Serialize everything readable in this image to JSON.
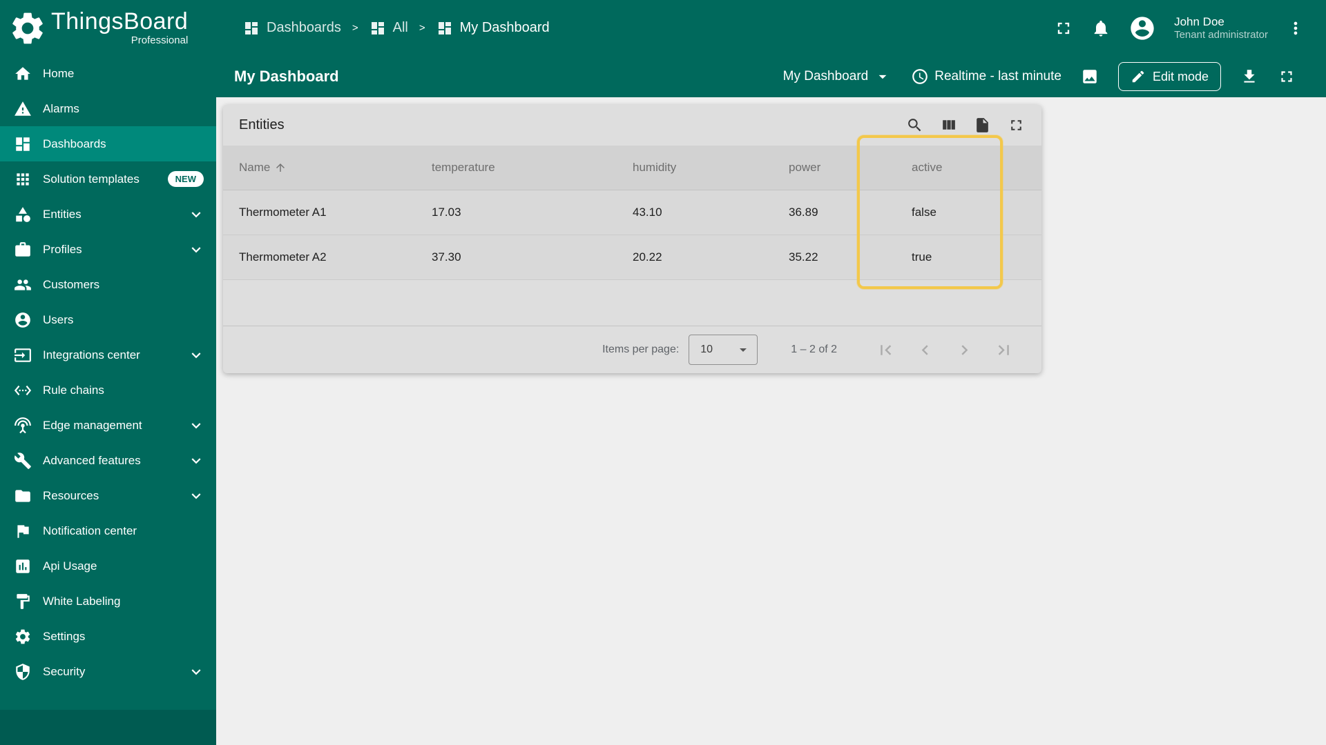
{
  "brand": {
    "name": "ThingsBoard",
    "edition": "Professional"
  },
  "breadcrumb": {
    "separator": ">",
    "items": [
      "Dashboards",
      "All",
      "My Dashboard"
    ]
  },
  "user": {
    "name": "John Doe",
    "role": "Tenant administrator"
  },
  "sidebar": {
    "items": [
      {
        "label": "Home"
      },
      {
        "label": "Alarms"
      },
      {
        "label": "Dashboards"
      },
      {
        "label": "Solution templates",
        "badge": "NEW"
      },
      {
        "label": "Entities"
      },
      {
        "label": "Profiles"
      },
      {
        "label": "Customers"
      },
      {
        "label": "Users"
      },
      {
        "label": "Integrations center"
      },
      {
        "label": "Rule chains"
      },
      {
        "label": "Edge management"
      },
      {
        "label": "Advanced features"
      },
      {
        "label": "Resources"
      },
      {
        "label": "Notification center"
      },
      {
        "label": "Api Usage"
      },
      {
        "label": "White Labeling"
      },
      {
        "label": "Settings"
      },
      {
        "label": "Security"
      }
    ]
  },
  "toolbar": {
    "title": "My Dashboard",
    "dashboard_selector": "My Dashboard",
    "timewindow": "Realtime - last minute",
    "edit_button": "Edit mode"
  },
  "widget": {
    "title": "Entities",
    "columns": [
      "Name",
      "temperature",
      "humidity",
      "power",
      "active"
    ],
    "rows": [
      [
        "Thermometer A1",
        "17.03",
        "43.10",
        "36.89",
        "false"
      ],
      [
        "Thermometer A2",
        "37.30",
        "20.22",
        "35.22",
        "true"
      ]
    ],
    "pagination": {
      "items_per_page_label": "Items per page:",
      "page_size": "10",
      "range": "1 – 2 of 2"
    }
  },
  "colors": {
    "primary": "#00695c",
    "sidebar_active": "#00897b",
    "widget_bg": "#dedede",
    "highlight": "#f3c84b"
  }
}
